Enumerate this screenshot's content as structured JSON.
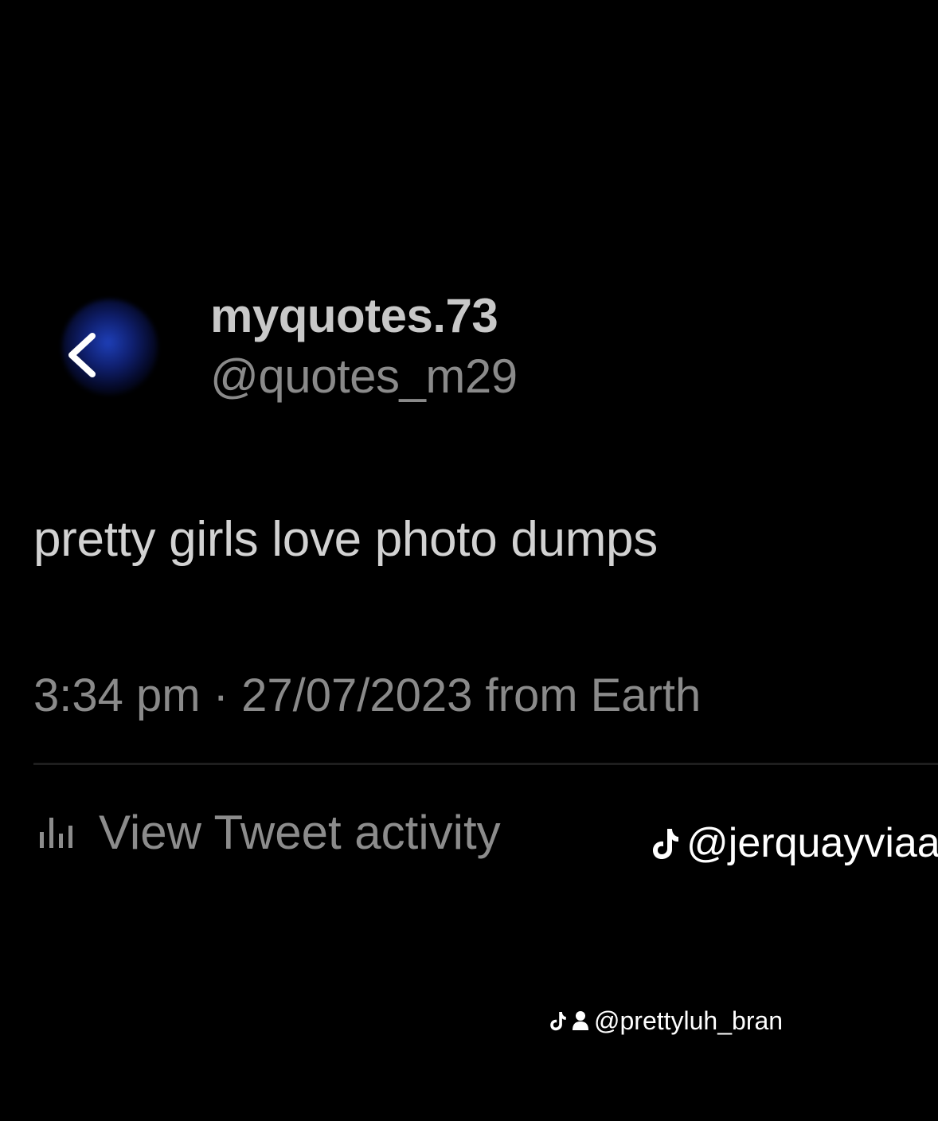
{
  "profile": {
    "display_name": "myquotes.73",
    "handle": "@quotes_m29",
    "avatar_color": "#1e3fb8"
  },
  "nav": {
    "back_icon": "chevron-left-icon"
  },
  "tweet": {
    "text": "pretty girls love photo dumps",
    "timestamp": "3:34 pm · 27/07/2023 from Earth"
  },
  "activity": {
    "icon": "bar-chart-icon",
    "label": "View Tweet activity"
  },
  "watermarks": {
    "primary": {
      "icon": "tiktok-icon",
      "text": "@jerquayviaa"
    },
    "secondary": {
      "icons": [
        "tiktok-icon",
        "user-icon"
      ],
      "text": "@prettyluh_bran"
    }
  },
  "colors": {
    "background": "#000000",
    "primary_text": "#d2d2d2",
    "secondary_text": "#8a8a8a",
    "watermark": "#ffffff"
  }
}
